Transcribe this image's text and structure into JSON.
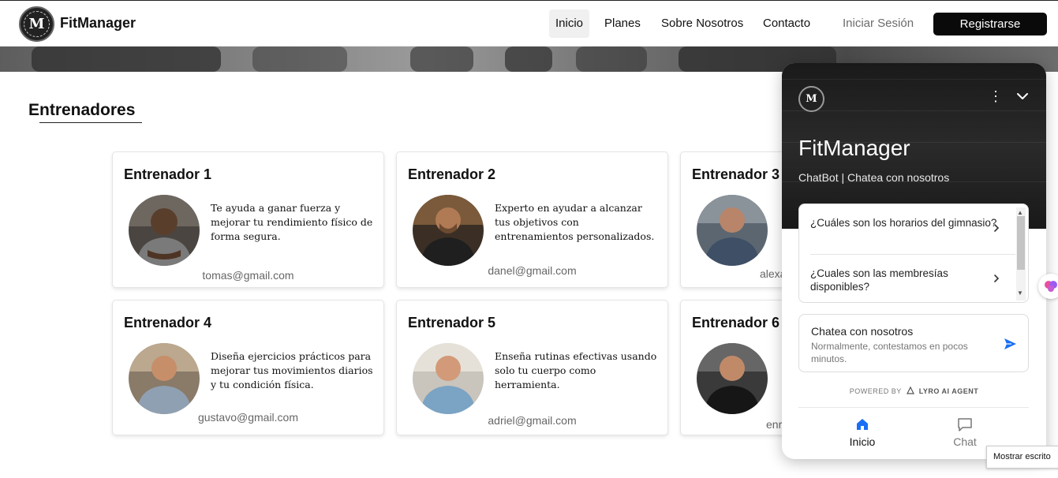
{
  "navbar": {
    "brand": "FitManager",
    "links": [
      "Inicio",
      "Planes",
      "Sobre Nosotros",
      "Contacto"
    ],
    "login": "Iniciar Sesión",
    "register": "Registrarse"
  },
  "section": {
    "title": "Entrenadores"
  },
  "trainers": [
    {
      "name": "Entrenador 1",
      "desc": "Te ayuda a ganar fuerza y mejorar tu rendimiento físico de forma segura.",
      "email": "tomas@gmail.com"
    },
    {
      "name": "Entrenador 2",
      "desc": "Experto en ayudar a alcanzar tus objetivos con entrenamientos personalizados.",
      "email": "danel@gmail.com"
    },
    {
      "name": "Entrenador 3",
      "desc": "",
      "email": "alexa"
    },
    {
      "name": "Entrenador 4",
      "desc": "Diseña ejercicios prácticos para mejorar tus movimientos diarios y tu condición física.",
      "email": "gustavo@gmail.com"
    },
    {
      "name": "Entrenador 5",
      "desc": "Enseña rutinas efectivas usando solo tu cuerpo como herramienta.",
      "email": "adriel@gmail.com"
    },
    {
      "name": "Entrenador 6",
      "desc": "",
      "email": "enri"
    }
  ],
  "chat": {
    "title": "FitManager",
    "subtitle": "ChatBot | Chatea con nosotros",
    "faqs": [
      "¿Cuáles son los horarios del gimnasio?",
      "¿Cuales son las membresías disponibles?"
    ],
    "contact_title": "Chatea con nosotros",
    "contact_desc": "Normalmente, contestamos en pocos minutos.",
    "powered_prefix": "POWERED BY",
    "powered_brand": "LYRO AI AGENT",
    "tabs": [
      "Inicio",
      "Chat"
    ]
  },
  "tooltip": "Mostrar escrito",
  "icons": [
    "logo-icon",
    "more-vertical-icon",
    "chevron-down-icon",
    "chevron-right-icon",
    "send-icon",
    "home-icon",
    "chat-icon",
    "brain-icon"
  ],
  "colors": {
    "primary": "#0a0a0a",
    "accent_blue": "#1a6ff3",
    "link_gray": "#6b6b6b"
  }
}
